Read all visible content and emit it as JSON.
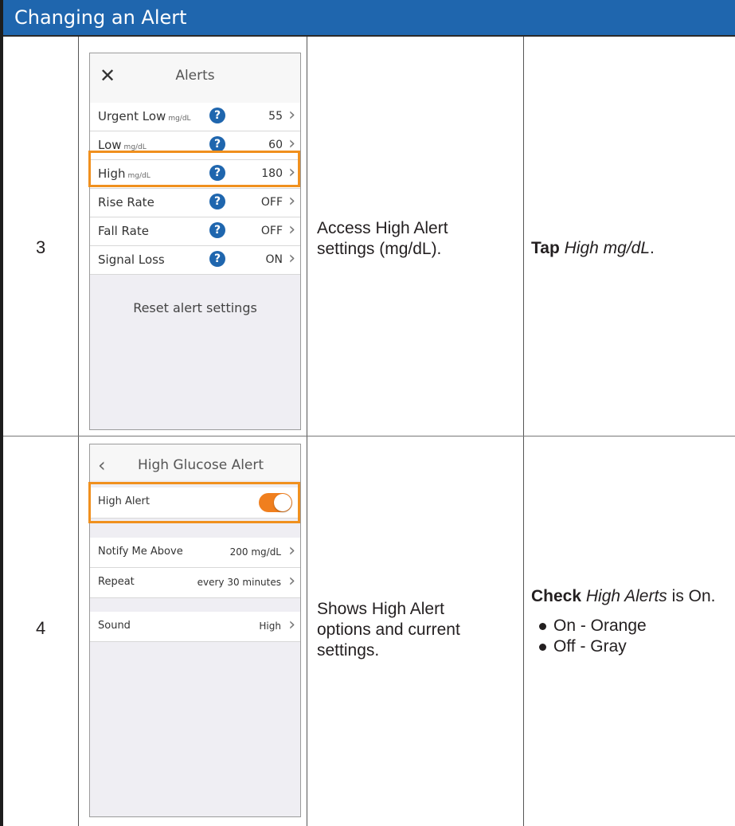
{
  "header": {
    "title": "Changing an Alert"
  },
  "colors": {
    "header_bg": "#1f66ae",
    "highlight": "#f0901e",
    "toggle_on": "#f07f1e",
    "help_icon": "#1f66ae"
  },
  "rows": [
    {
      "step": "3",
      "description": "Access High Alert settings (mg/dL).",
      "description_lines": [
        "Access High Alert",
        "settings (mg/dL)."
      ],
      "action": {
        "verb": "Tap",
        "target": "High mg/dL",
        "end": "."
      },
      "screen": {
        "title": "Alerts",
        "close_icon": "close-icon",
        "items": [
          {
            "label": "Urgent Low",
            "unit": "mg/dL",
            "help": "?",
            "value": "55"
          },
          {
            "label": "Low",
            "unit": "mg/dL",
            "help": "?",
            "value": "60"
          },
          {
            "label": "High",
            "unit": "mg/dL",
            "help": "?",
            "value": "180"
          },
          {
            "label": "Rise Rate",
            "unit": "",
            "help": "?",
            "value": "OFF"
          },
          {
            "label": "Fall Rate",
            "unit": "",
            "help": "?",
            "value": "OFF"
          },
          {
            "label": "Signal Loss",
            "unit": "",
            "help": "?",
            "value": "ON"
          }
        ],
        "reset_label": "Reset alert settings"
      }
    },
    {
      "step": "4",
      "description": "Shows High Alert options and current settings.",
      "description_lines": [
        "Shows High Alert",
        "options and current",
        "settings."
      ],
      "action": {
        "verb": "Check",
        "target": "High Alerts",
        "end": " is On.",
        "bullets": [
          "On - Orange",
          "Off - Gray"
        ]
      },
      "screen": {
        "title": "High Glucose Alert",
        "back_icon": "chevron-left-icon",
        "toggle": {
          "label": "High Alert",
          "state": "on"
        },
        "items": [
          {
            "label": "Notify Me Above",
            "value": "200 mg/dL"
          },
          {
            "label": "Repeat",
            "value": "every 30 minutes"
          },
          {
            "label": "Sound",
            "value": "High"
          }
        ]
      }
    }
  ]
}
